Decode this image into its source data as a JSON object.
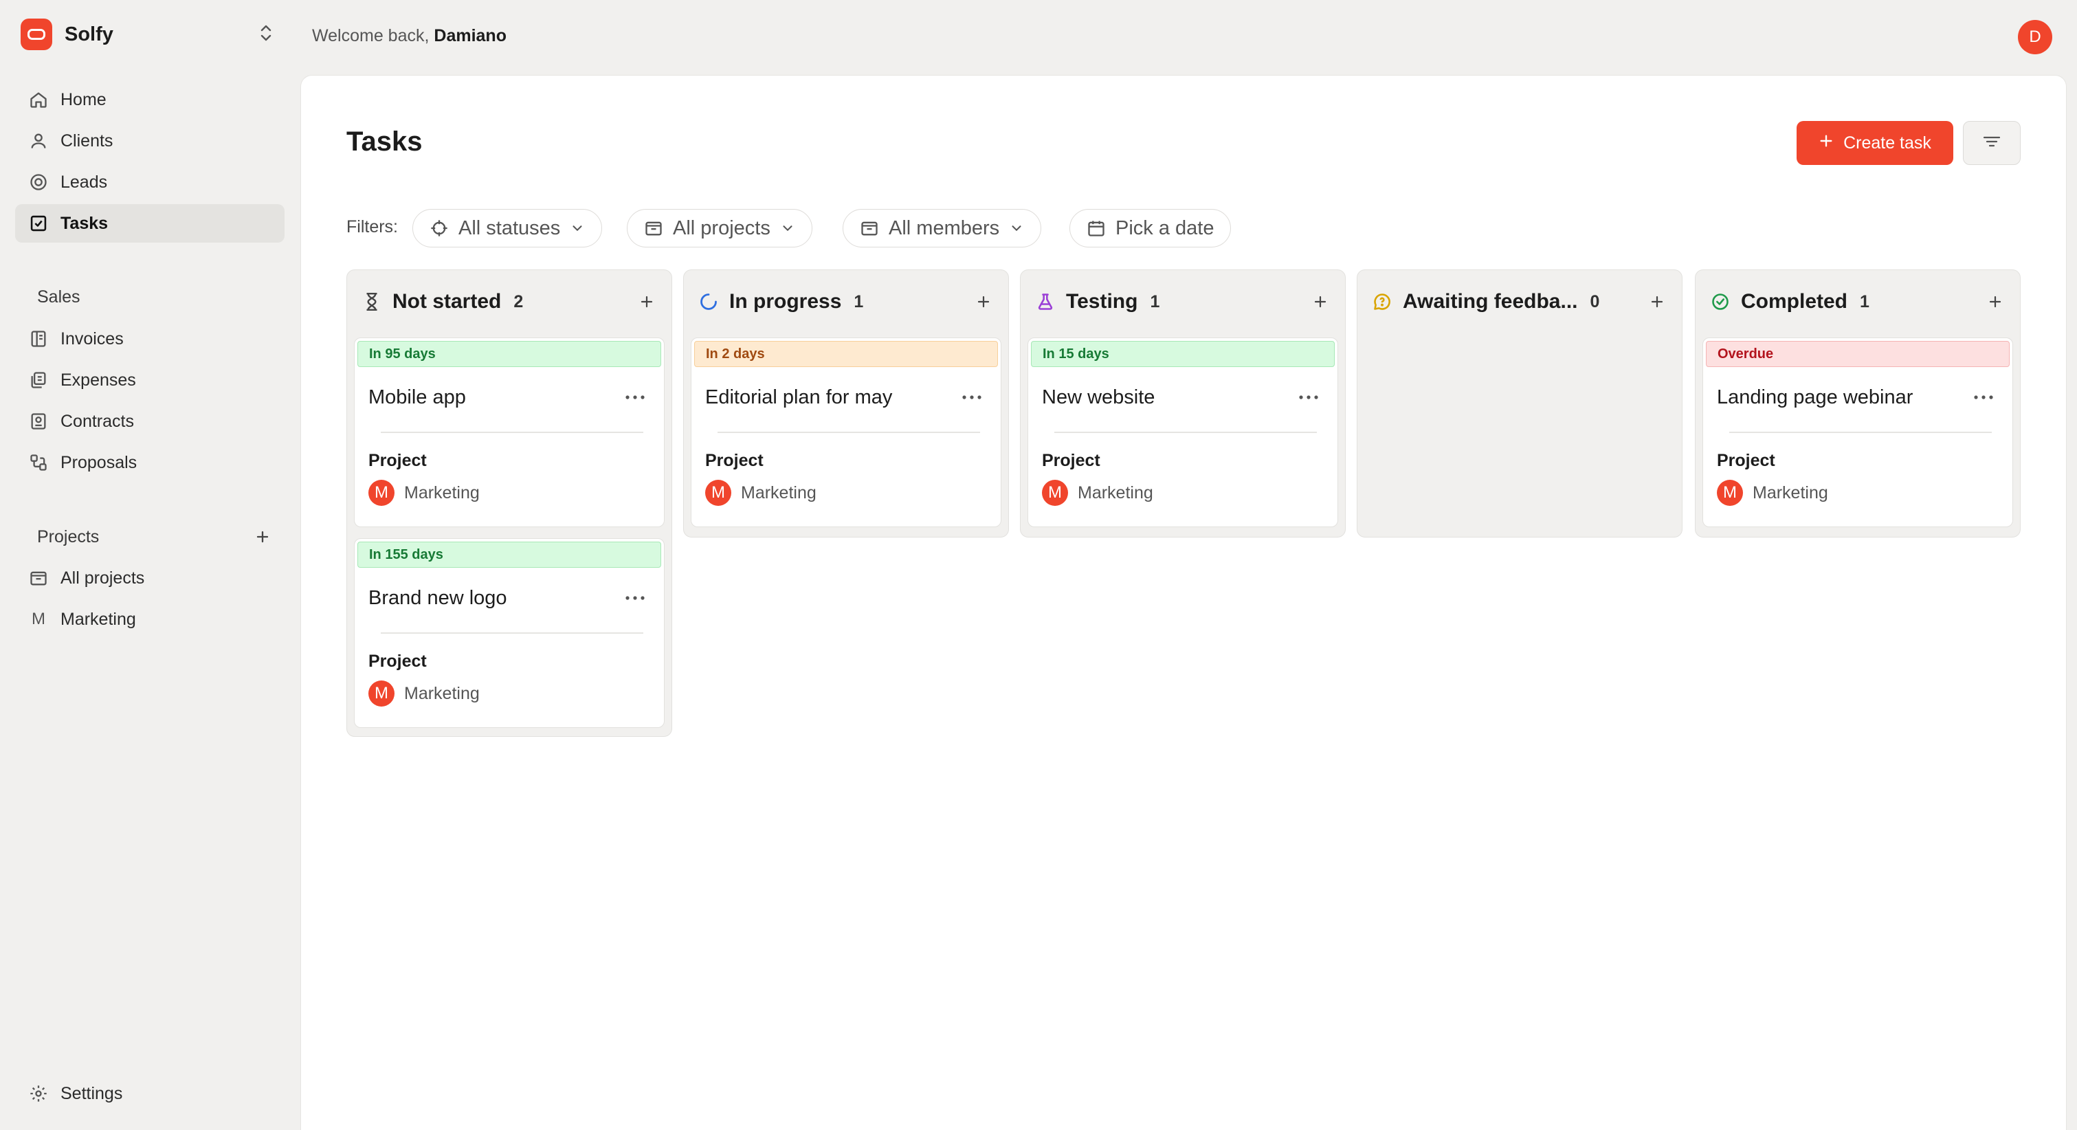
{
  "app": {
    "name": "Solfy"
  },
  "colors": {
    "accent": "#f0452c",
    "panel": "#ffffff",
    "background": "#f1f0ee"
  },
  "sidebar": {
    "main_items": [
      {
        "label": "Home",
        "icon": "home-icon"
      },
      {
        "label": "Clients",
        "icon": "user-icon"
      },
      {
        "label": "Leads",
        "icon": "target-icon"
      },
      {
        "label": "Tasks",
        "icon": "checkbox-icon",
        "active": true
      }
    ],
    "sales_title": "Sales",
    "sales_items": [
      {
        "label": "Invoices",
        "icon": "invoice-icon"
      },
      {
        "label": "Expenses",
        "icon": "expense-icon"
      },
      {
        "label": "Contracts",
        "icon": "contract-icon"
      },
      {
        "label": "Proposals",
        "icon": "proposal-icon"
      }
    ],
    "projects_title": "Projects",
    "projects_items": [
      {
        "label": "All projects",
        "icon": "folder-icon"
      },
      {
        "label": "Marketing",
        "letter": "M"
      }
    ],
    "settings_label": "Settings"
  },
  "header": {
    "welcome_prefix": "Welcome back,",
    "user_name": "Damiano",
    "avatar_letter": "D"
  },
  "page": {
    "title": "Tasks",
    "create_label": "Create task",
    "filters_label": "Filters:",
    "filters": {
      "status": "All statuses",
      "projects": "All projects",
      "members": "All members",
      "date": "Pick a date"
    }
  },
  "board": {
    "project_label": "Project",
    "columns": [
      {
        "name": "Not started",
        "count": "2",
        "icon": "hourglass-icon",
        "cards": [
          {
            "due": "In 95 days",
            "due_tone": "green",
            "title": "Mobile app",
            "project": "Marketing",
            "project_letter": "M"
          },
          {
            "due": "In 155 days",
            "due_tone": "green",
            "title": "Brand new logo",
            "project": "Marketing",
            "project_letter": "M"
          }
        ]
      },
      {
        "name": "In progress",
        "count": "1",
        "icon": "spinner-icon",
        "cards": [
          {
            "due": "In 2 days",
            "due_tone": "orange",
            "title": "Editorial plan for may",
            "project": "Marketing",
            "project_letter": "M"
          }
        ]
      },
      {
        "name": "Testing",
        "count": "1",
        "icon": "flask-icon",
        "cards": [
          {
            "due": "In 15 days",
            "due_tone": "green",
            "title": "New website",
            "project": "Marketing",
            "project_letter": "M"
          }
        ]
      },
      {
        "name": "Awaiting feedba...",
        "count": "0",
        "icon": "feedback-icon",
        "cards": []
      },
      {
        "name": "Completed",
        "count": "1",
        "icon": "check-circle-icon",
        "cards": [
          {
            "due": "Overdue",
            "due_tone": "red",
            "title": "Landing page webinar",
            "project": "Marketing",
            "project_letter": "M"
          }
        ]
      }
    ]
  }
}
